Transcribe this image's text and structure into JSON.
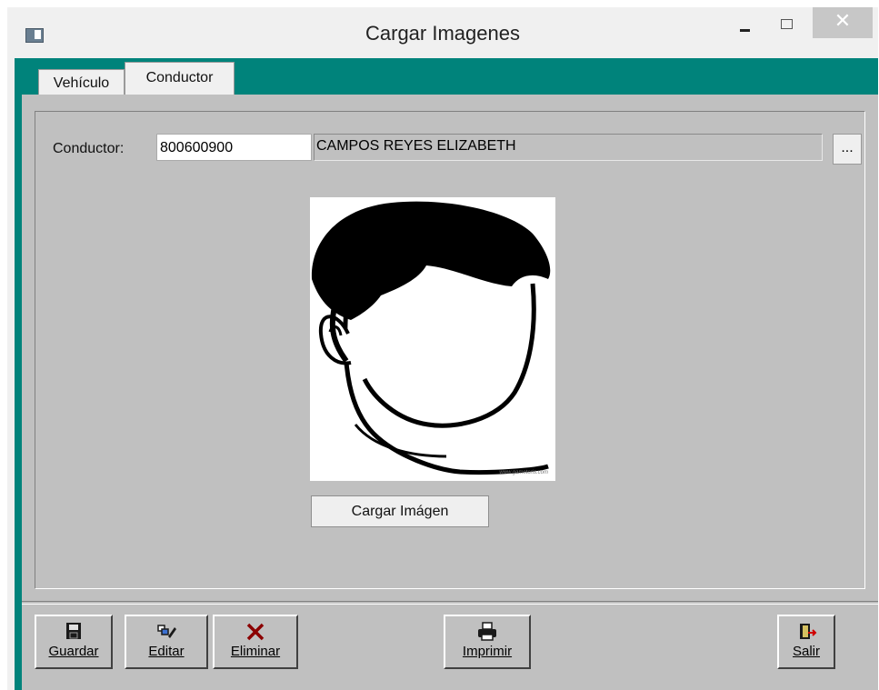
{
  "window": {
    "title": "Cargar Imagenes",
    "controls": {
      "minimize": "",
      "maximize": "",
      "close": "✕"
    }
  },
  "tabs": [
    {
      "label": "Vehículo",
      "active": false
    },
    {
      "label": "Conductor",
      "active": true
    }
  ],
  "form": {
    "conductor_label": "Conductor:",
    "conductor_id": "800600900",
    "conductor_name": "CAMPOS REYES ELIZABETH",
    "browse_label": "...",
    "photo_icon": "person-silhouette-icon",
    "upload_label": "Cargar Imágen"
  },
  "toolbar": {
    "guardar": "Guardar",
    "editar": "Editar",
    "eliminar": "Eliminar",
    "imprimir": "Imprimir",
    "salir": "Salir"
  },
  "colors": {
    "tab_strip": "#00837b",
    "panel": "#c0c0c0",
    "delete_icon": "#8b0000"
  }
}
